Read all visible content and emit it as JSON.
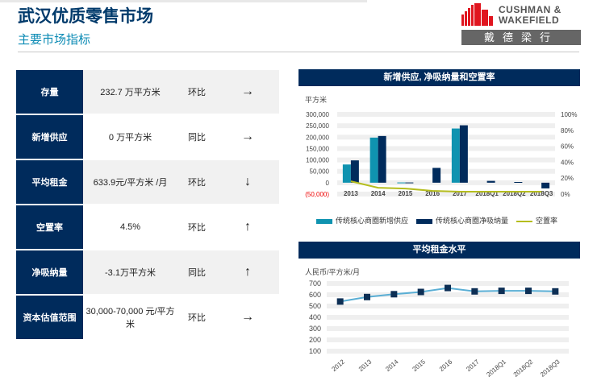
{
  "header": {
    "title": "武汉优质零售市场",
    "subtitle": "主要市场指标"
  },
  "logo": {
    "name_line1": "CUSHMAN &",
    "name_line2": "WAKEFIELD",
    "chinese": "戴德梁行"
  },
  "indicators": [
    {
      "label": "存量",
      "value": "232.7 万平方米",
      "compare": "环比",
      "arrow": "→"
    },
    {
      "label": "新增供应",
      "value": "0 万平方米",
      "compare": "同比",
      "arrow": "→"
    },
    {
      "label": "平均租金",
      "value": "633.9元/平方米 /月",
      "compare": "环比",
      "arrow": "↓"
    },
    {
      "label": "空置率",
      "value": "4.5%",
      "compare": "环比",
      "arrow": "↑"
    },
    {
      "label": "净吸纳量",
      "value": "-3.1万平方米",
      "compare": "同比",
      "arrow": "↑"
    },
    {
      "label": "资本估值范围",
      "value": "30,000-70,000 元/平方米",
      "compare": "环比",
      "arrow": "→"
    }
  ],
  "colors": {
    "navy": "#002b5c",
    "teal": "#0f93b0",
    "olive": "#b5bd1e",
    "line": "#5aaed4"
  },
  "chart_data": [
    {
      "type": "bar",
      "title": "新增供应, 净吸纳量和空置率",
      "ylabel": "平方米",
      "categories": [
        "2013",
        "2014",
        "2015",
        "2016",
        "2017",
        "2018Q1",
        "2018Q2",
        "2018Q3"
      ],
      "ylim": [
        -50000,
        300000
      ],
      "yticks": [
        "(50,000)",
        "0",
        "50,000",
        "100,000",
        "150,000",
        "200,000",
        "250,000",
        "300,000"
      ],
      "y2lim": [
        0,
        100
      ],
      "y2ticks": [
        "0%",
        "20%",
        "40%",
        "60%",
        "80%",
        "100%"
      ],
      "series": [
        {
          "name": "传统核心商圈新增供应",
          "type": "bar",
          "values": [
            80000,
            198000,
            1000,
            0,
            238000,
            0,
            0,
            0
          ]
        },
        {
          "name": "传统核心商圈净吸纳量",
          "type": "bar",
          "values": [
            98000,
            205000,
            1000,
            65000,
            252000,
            8000,
            3000,
            -25000
          ]
        },
        {
          "name": "空置率",
          "type": "line",
          "axis": "right",
          "values": [
            16,
            8,
            7,
            4,
            3,
            3,
            3,
            3
          ]
        }
      ],
      "legend": "bottom"
    },
    {
      "type": "line",
      "title": "平均租金水平",
      "ylabel": "人民币/平方米/月",
      "categories": [
        "2012",
        "2013",
        "2014",
        "2015",
        "2016",
        "2017",
        "2018Q1",
        "2018Q2",
        "2018Q3"
      ],
      "ylim": [
        100,
        700
      ],
      "yticks": [
        "100",
        "200",
        "300",
        "400",
        "500",
        "600",
        "700"
      ],
      "series": [
        {
          "name": "平均租金",
          "values": [
            540,
            580,
            605,
            625,
            660,
            630,
            635,
            635,
            630
          ]
        }
      ]
    }
  ]
}
